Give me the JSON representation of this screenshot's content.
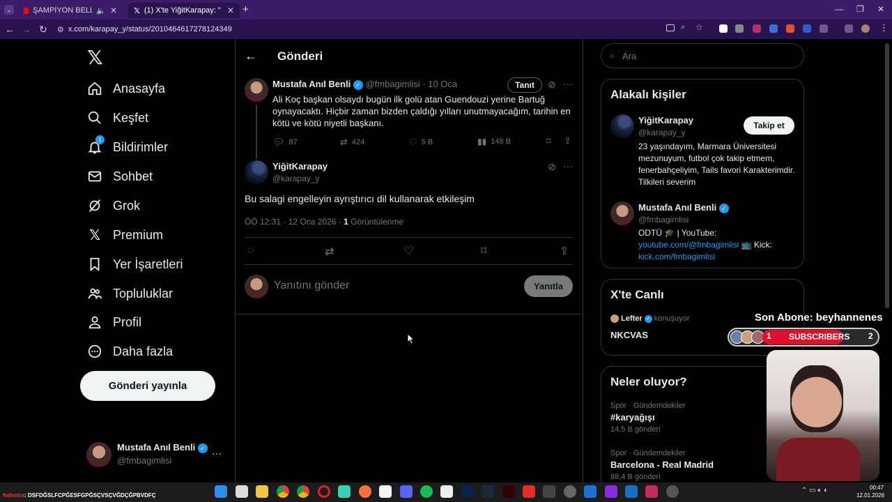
{
  "browser": {
    "tabs": [
      {
        "title": "ŞAMPİYON BELLİ OLUYO…",
        "icon": "youtube-icon",
        "active": false
      },
      {
        "title": "(1) X'te YiğitKarapay: \"@fmbag…",
        "icon": "x-icon",
        "active": true
      }
    ],
    "new_tab": "+",
    "url": "x.com/karapay_y/status/2010464617278124349"
  },
  "left_nav": {
    "items": [
      {
        "label": "Anasayfa",
        "icon": "home-icon"
      },
      {
        "label": "Keşfet",
        "icon": "search-icon"
      },
      {
        "label": "Bildirimler",
        "icon": "bell-icon",
        "badge": "1"
      },
      {
        "label": "Sohbet",
        "icon": "mail-icon"
      },
      {
        "label": "Grok",
        "icon": "grok-icon"
      },
      {
        "label": "Premium",
        "icon": "x-icon"
      },
      {
        "label": "Yer İşaretleri",
        "icon": "bookmark-icon"
      },
      {
        "label": "Topluluklar",
        "icon": "people-icon"
      },
      {
        "label": "Profil",
        "icon": "person-icon"
      },
      {
        "label": "Daha fazla",
        "icon": "more-circle-icon"
      }
    ],
    "post_button": "Gönderi yayınla",
    "account": {
      "name": "Mustafa Anıl Benli",
      "handle": "@fmbagimlisi",
      "more": "···"
    }
  },
  "main": {
    "header": "Gönderi",
    "parent_tweet": {
      "name": "Mustafa Anıl Benli",
      "handle": "@fmbagimlisi",
      "date": "· 10 Oca",
      "follow_button": "Tanıt",
      "text": "Ali Koç başkan olsaydı bugün ilk golü atan Guendouzi yerine Bartuğ oynayacaktı. Hiçbir zaman bizden çaldığı yılları unutmayacağım, tarihin en kötü ve kötü niyetli başkanı.",
      "replies": "87",
      "reposts": "424",
      "likes": "5 B",
      "views": "148 B"
    },
    "tweet": {
      "name": "YiğitKarapay",
      "handle": "@karapay_y",
      "text": "Bu salagi engelleyin ayrıştırıcı dil kullanarak etkileşim",
      "time": "ÖÖ 12:31 · 12 Oca 2026 · ",
      "views_count": "1",
      "views_label": " Görüntülenme"
    },
    "reply": {
      "placeholder": "Yanıtını gönder",
      "button": "Yanıtla"
    }
  },
  "right": {
    "search_placeholder": "Ara",
    "relevant": {
      "title": "Alakalı kişiler",
      "people": [
        {
          "name": "YiğitKarapay",
          "handle": "@karapay_y",
          "follow": "Takip et",
          "bio": "23 yaşındayım, Marmara Üniversitesi mezunuyum, futbol çok takip etmem, fenerbahçeliyim, Tails favori Karakterimdir. Tilkileri severim"
        },
        {
          "name": "Mustafa Anıl Benli",
          "handle": "@fmbagimlisi",
          "bio_prefix": "ODTÜ 🎓 | YouTube:",
          "bio_link1": "youtube.com/@fmbagimlisi",
          "bio_mid": " 📺 Kick:",
          "bio_link2": "kick.com/fmbagimlisi"
        }
      ]
    },
    "live": {
      "title": "X'te Canlı",
      "host": "Lefter",
      "status": "konuşuyor",
      "space": "NKCVAS"
    },
    "trends": {
      "title": "Neler oluyor?",
      "items": [
        {
          "category": "Spor · Gündemdekiler",
          "name": "#karyağışı",
          "count": "14,5 B gönderi"
        },
        {
          "category": "Spor · Gündemdekiler",
          "name": "Barcelona - Real Madrid",
          "count": "88,4 B gönderi"
        }
      ]
    }
  },
  "overlay": {
    "last_sub": "Son Abone: beyhannenes",
    "sub_left": "1",
    "sub_label": "SUBSCRIBERS",
    "sub_right": "2"
  },
  "taskbar": {
    "ticker_user": "fedestra",
    "ticker_text": ": DSFDĞSLFCPĞESFGPĞSÇVSÇVĞDÇĞPBVDFÇ",
    "time": "00:47",
    "date": "12.01.2026"
  },
  "colors": {
    "accent": "#1d9bf0",
    "tab_bar": "#3a1d66",
    "background": "#000000"
  }
}
